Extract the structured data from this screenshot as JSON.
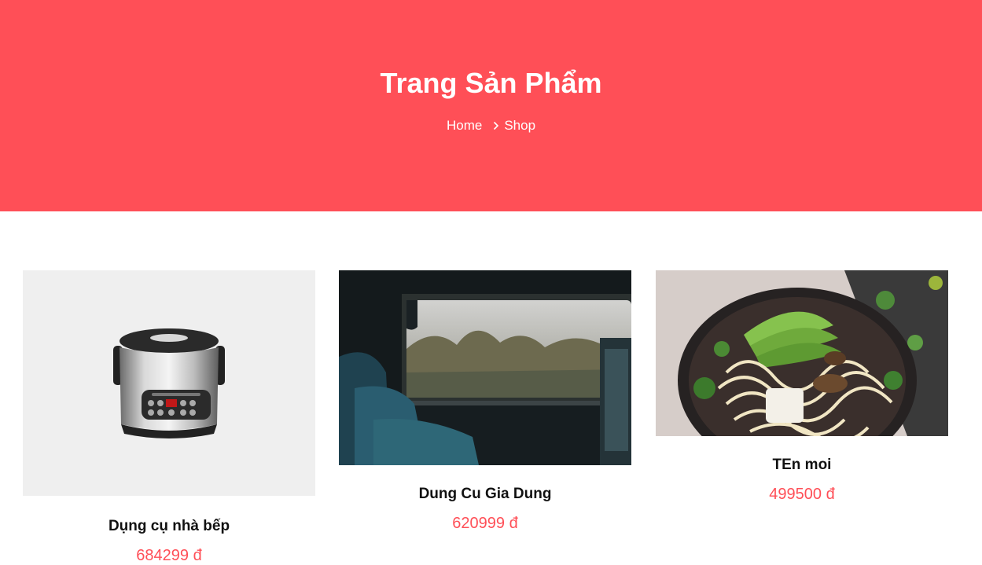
{
  "colors": {
    "accent": "#ff4f57",
    "title_text": "#111111",
    "placeholder_bg": "#efefef"
  },
  "hero": {
    "title": "Trang Sản Phẩm",
    "breadcrumb": {
      "home": "Home",
      "separator_icon": "chevron-right-icon",
      "current": "Shop"
    }
  },
  "products": [
    {
      "name": "Dụng cụ nhà bếp",
      "price": "684299 đ",
      "image": "rice-cooker"
    },
    {
      "name": "Dung Cu Gia Dung",
      "price": "620999 đ",
      "image": "train-window"
    },
    {
      "name": "TEn moi",
      "price": "499500 đ",
      "image": "noodle-bowl"
    }
  ]
}
